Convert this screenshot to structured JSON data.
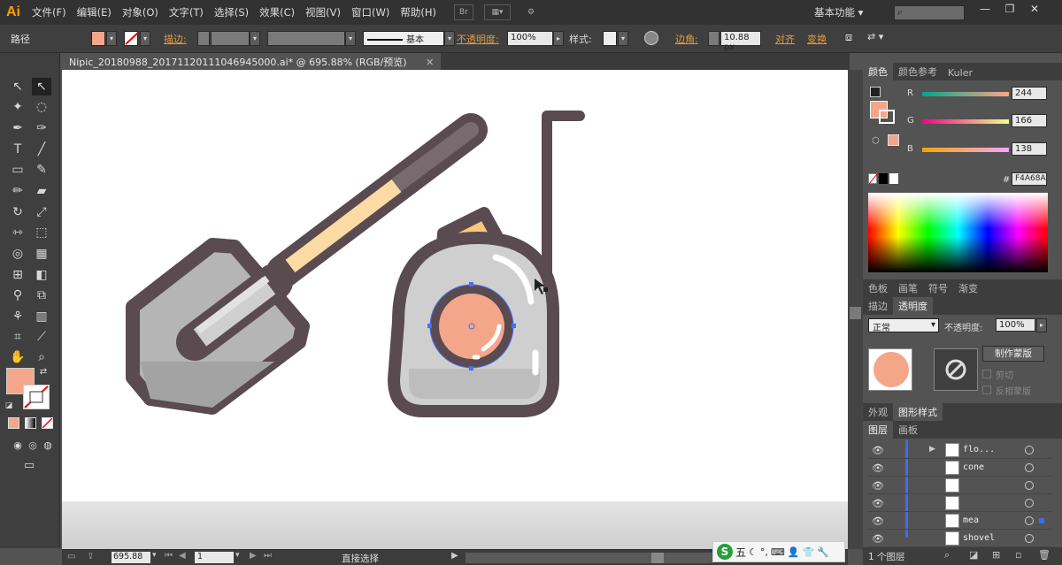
{
  "app": {
    "logo": "Ai",
    "workspace": "基本功能",
    "document_tab": "Nipic_20180988_20171120111046945000.ai* @ 695.88% (RGB/预览)"
  },
  "menu": [
    "文件(F)",
    "编辑(E)",
    "对象(O)",
    "文字(T)",
    "选择(S)",
    "效果(C)",
    "视图(V)",
    "窗口(W)",
    "帮助(H)"
  ],
  "menu_icons": [
    "Br",
    "▦▾",
    "⚙"
  ],
  "control": {
    "selection_type": "路径",
    "stroke_label": "描边:",
    "stroke_profile": "基本",
    "opacity_label": "不透明度:",
    "opacity_value": "100%",
    "style_label": "样式:",
    "corner_label": "边角:",
    "corner_value": "10.88 px",
    "align_label": "对齐",
    "transform_label": "变换"
  },
  "colors": {
    "fill": "#F4A68A",
    "outline": "#5a4b50",
    "shovel_gray": "#b5b5b5",
    "shovel_light": "#d4d4d4",
    "handle_wood": "#fbdaa3",
    "handle_grip": "#786a6f",
    "tape_body": "#cfcfcf",
    "tape_cap": "#f7c97a"
  },
  "color_panel": {
    "tabs": [
      "颜色",
      "颜色参考",
      "Kuler"
    ],
    "r_label": "R",
    "r_value": "244",
    "g_label": "G",
    "g_value": "166",
    "b_label": "B",
    "b_value": "138",
    "r": 244,
    "g": 166,
    "b": 138,
    "hex_label": "#",
    "hex_value": "F4A68A"
  },
  "swatch_tabs": [
    "色板",
    "画笔",
    "符号",
    "渐变"
  ],
  "transparency_panel": {
    "tabs": [
      "描边",
      "透明度"
    ],
    "blend_mode": "正常",
    "opacity_label": "不透明度:",
    "opacity_value": "100%",
    "make_mask": "制作蒙版",
    "clip": "剪切",
    "invert_mask": "反相蒙版"
  },
  "appearance_tabs": [
    "外观",
    "图形样式"
  ],
  "layers_panel": {
    "tabs": [
      "图层",
      "画板"
    ],
    "layers": [
      "flo...",
      "cone",
      "",
      "",
      "mea",
      "shovel"
    ],
    "footer_count": "1 个图层"
  },
  "status": {
    "zoom": "695.88",
    "artboard": "1",
    "tool": "直接选择"
  },
  "ime": {
    "label": "五"
  }
}
